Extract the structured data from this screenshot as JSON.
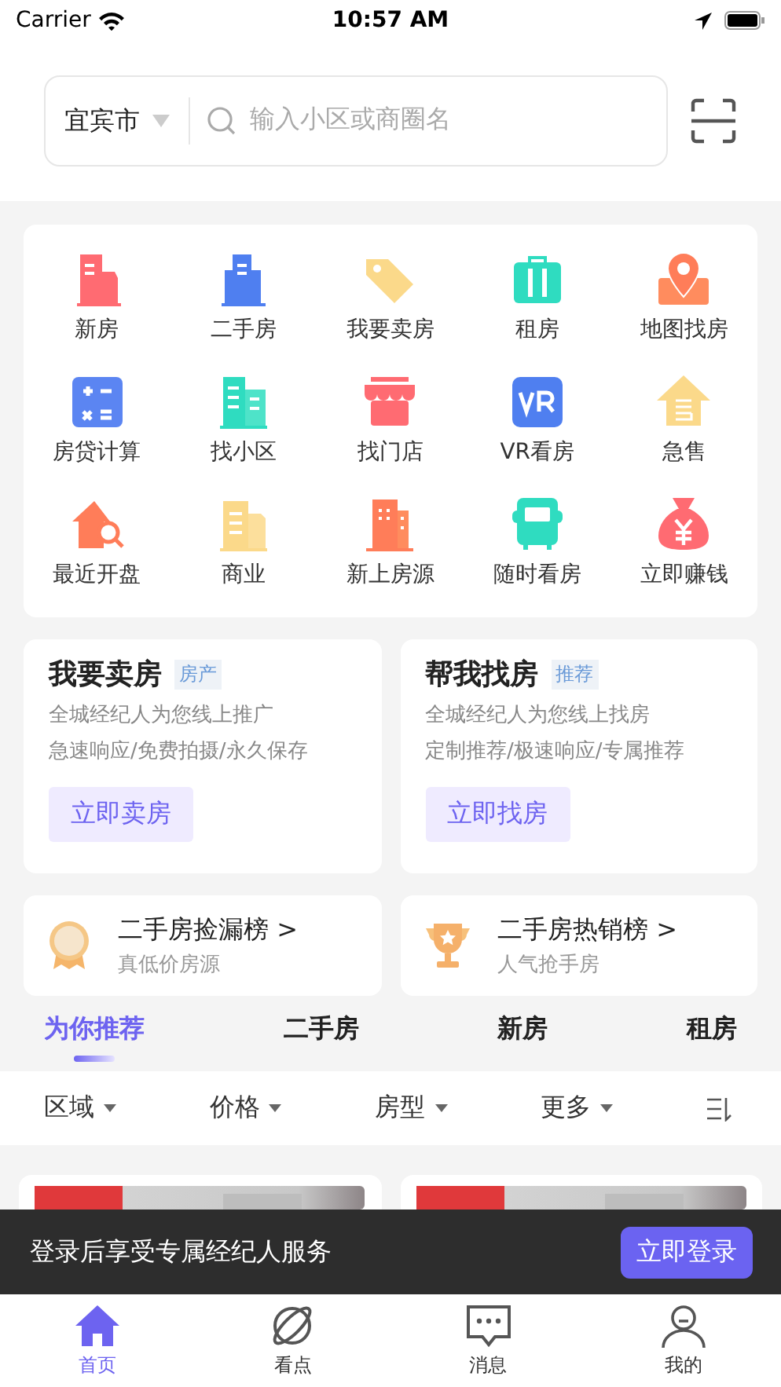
{
  "status_bar": {
    "carrier": "Carrier",
    "time": "10:57 AM"
  },
  "search": {
    "city": "宜宾市",
    "placeholder": "输入小区或商圈名"
  },
  "shortcuts": [
    {
      "label": "新房"
    },
    {
      "label": "二手房"
    },
    {
      "label": "我要卖房"
    },
    {
      "label": "租房"
    },
    {
      "label": "地图找房"
    },
    {
      "label": "房贷计算"
    },
    {
      "label": "找小区"
    },
    {
      "label": "找门店"
    },
    {
      "label": "VR看房"
    },
    {
      "label": "急售"
    },
    {
      "label": "最近开盘"
    },
    {
      "label": "商业"
    },
    {
      "label": "新上房源"
    },
    {
      "label": "随时看房"
    },
    {
      "label": "立即赚钱"
    }
  ],
  "promo_cards": [
    {
      "title": "我要卖房",
      "tag": "房产",
      "lines": [
        "全城经纪人为您线上推广",
        "急速响应/免费拍摄/永久保存"
      ],
      "button": "立即卖房"
    },
    {
      "title": "帮我找房",
      "tag": "推荐",
      "lines": [
        "全城经纪人为您线上找房",
        "定制推荐/极速响应/专属推荐"
      ],
      "button": "立即找房"
    }
  ],
  "rankings": [
    {
      "title": "二手房捡漏榜 >",
      "subtitle": "真低价房源"
    },
    {
      "title": "二手房热销榜 >",
      "subtitle": "人气抢手房"
    }
  ],
  "tabs": [
    {
      "label": "为你推荐",
      "selected": true
    },
    {
      "label": "二手房",
      "selected": false
    },
    {
      "label": "新房",
      "selected": false
    },
    {
      "label": "租房",
      "selected": false
    }
  ],
  "filters": [
    {
      "label": "区域"
    },
    {
      "label": "价格"
    },
    {
      "label": "房型"
    },
    {
      "label": "更多"
    }
  ],
  "login_banner": {
    "text": "登录后享受专属经纪人服务",
    "button": "立即登录"
  },
  "tab_bar": [
    {
      "label": "首页",
      "selected": true
    },
    {
      "label": "看点",
      "selected": false
    },
    {
      "label": "消息",
      "selected": false
    },
    {
      "label": "我的",
      "selected": false
    }
  ]
}
